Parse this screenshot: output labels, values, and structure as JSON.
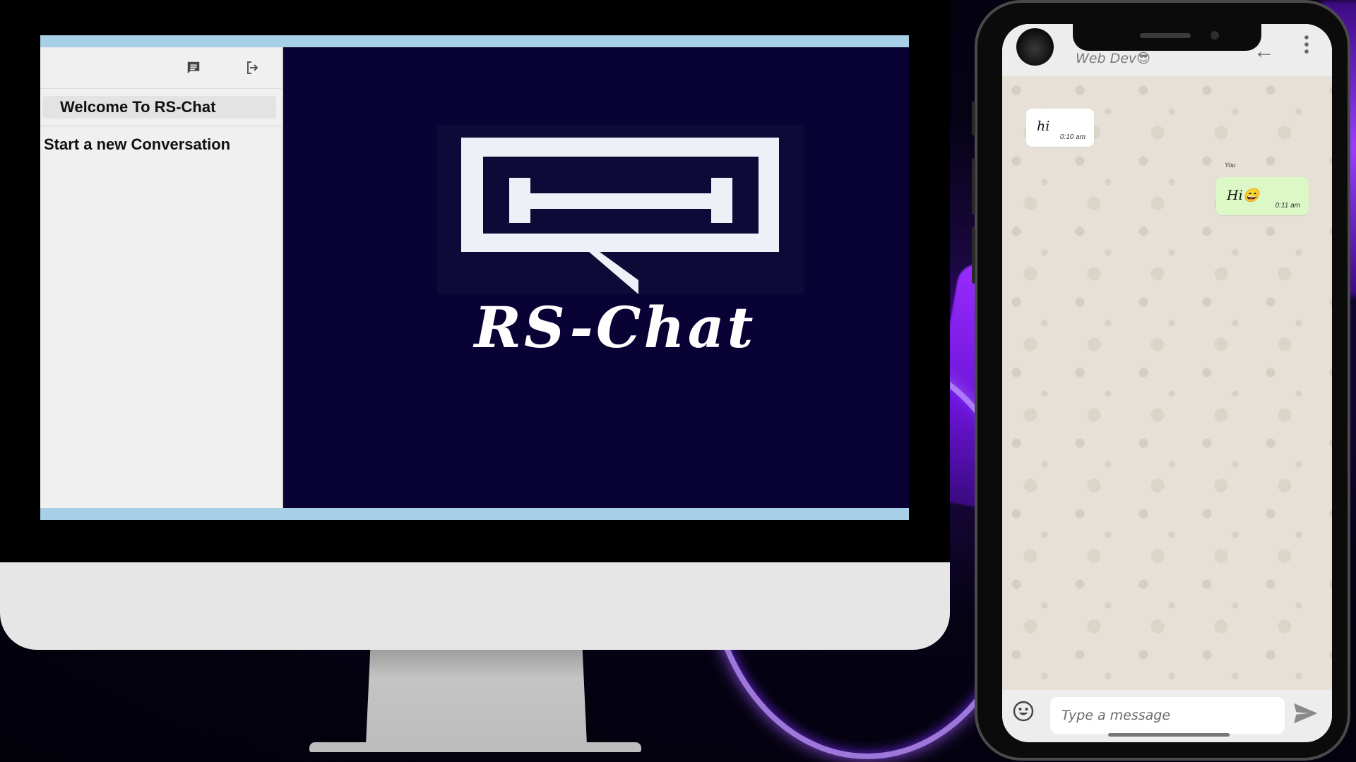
{
  "desktop": {
    "sidebar": {
      "new_chat_icon": "chat-icon",
      "logout_icon": "logout-icon",
      "welcome_text": "Welcome To RS-Chat",
      "start_conversation": "Start a new Conversation"
    },
    "main": {
      "logo_text": "RS-Chat",
      "logo_icon": "rs-chat-logo"
    }
  },
  "phone": {
    "header": {
      "contact_name": "Web Dev😎",
      "back_icon": "arrow-back-icon",
      "menu_icon": "more-vertical-icon"
    },
    "messages": [
      {
        "direction": "incoming",
        "text": "hi",
        "time": "0:10 am",
        "sender": ""
      },
      {
        "direction": "outgoing",
        "text": "Hi😄",
        "time": "0:11 am",
        "sender": "You"
      }
    ],
    "input": {
      "placeholder": "Type a message",
      "emoji_icon": "emoji-icon",
      "send_icon": "send-icon"
    }
  },
  "colors": {
    "main_pane": "#090235",
    "sidebar": "#f0f0f0",
    "outgoing_bubble": "#dcf8c6",
    "incoming_bubble": "#ffffff",
    "accent_glow": "#9b3cff"
  }
}
